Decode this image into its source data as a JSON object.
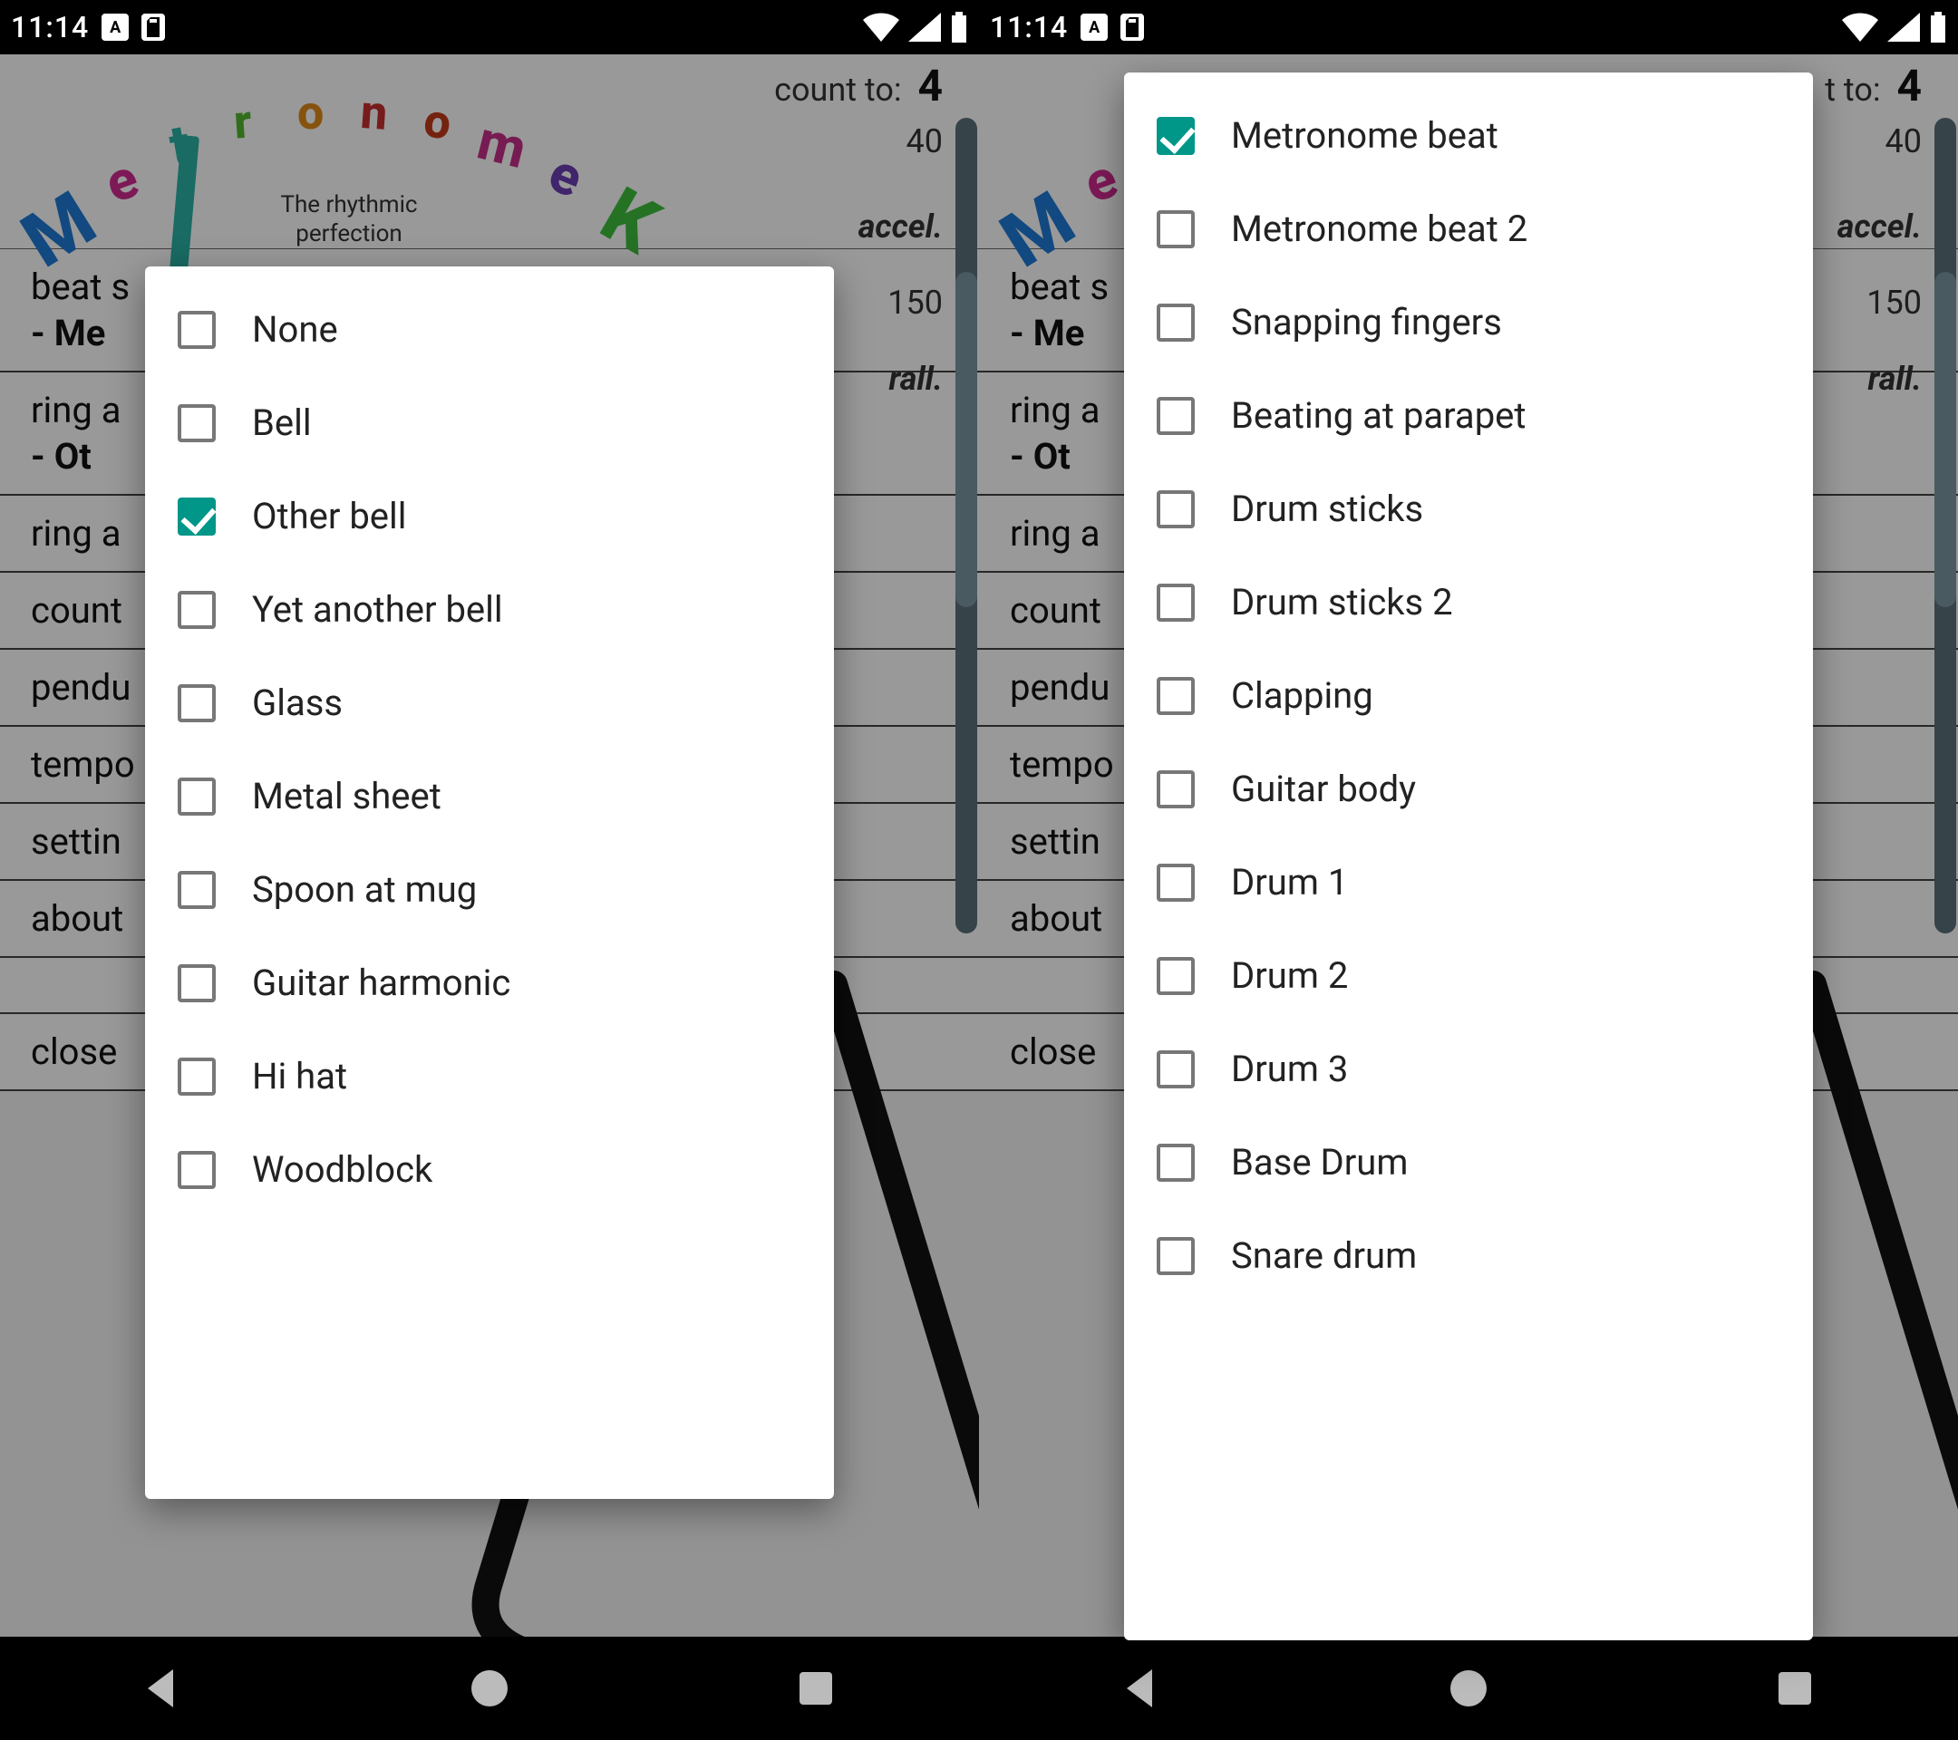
{
  "status": {
    "time": "11:14"
  },
  "app": {
    "tagline_l1": "The rhythmic",
    "tagline_l2": "perfection",
    "logo_letters": [
      {
        "ch": "M",
        "color": "#1e7ad6"
      },
      {
        "ch": "e",
        "color": "#d12b8f"
      },
      {
        "ch": "t",
        "color": "#2ab3a6"
      },
      {
        "ch": "r",
        "color": "#53b82e"
      },
      {
        "ch": "o",
        "color": "#e08b1a"
      },
      {
        "ch": "n",
        "color": "#c72f2f"
      },
      {
        "ch": "o",
        "color": "#c23b1a"
      },
      {
        "ch": "m",
        "color": "#c72f8a"
      },
      {
        "ch": "e",
        "color": "#6b3db5"
      },
      {
        "ch": "K",
        "color": "#3fbf3f"
      }
    ]
  },
  "menu": {
    "beat_line1": "beat s",
    "beat_line2": "- Me",
    "ring_line1": "ring a",
    "ring_line2": "- Ot",
    "ring2": "ring a",
    "count": "count",
    "pendu": "pendu",
    "tempo": "tempo",
    "settin": "settin",
    "about": "about",
    "close": "close"
  },
  "right": {
    "count_label": "count to:",
    "count_val": "4",
    "num1": "40",
    "accel": "accel.",
    "num2": "150",
    "rall": "rall.",
    "right_cut": "t to:"
  },
  "popup_left": {
    "options": [
      {
        "label": "None",
        "checked": false
      },
      {
        "label": "Bell",
        "checked": false
      },
      {
        "label": "Other bell",
        "checked": true
      },
      {
        "label": "Yet another bell",
        "checked": false
      },
      {
        "label": "Glass",
        "checked": false
      },
      {
        "label": "Metal sheet",
        "checked": false
      },
      {
        "label": "Spoon at mug",
        "checked": false
      },
      {
        "label": "Guitar harmonic",
        "checked": false
      },
      {
        "label": "Hi hat",
        "checked": false
      },
      {
        "label": "Woodblock",
        "checked": false
      }
    ]
  },
  "popup_right": {
    "options": [
      {
        "label": "Metronome beat",
        "checked": true
      },
      {
        "label": "Metronome beat 2",
        "checked": false
      },
      {
        "label": "Snapping fingers",
        "checked": false
      },
      {
        "label": "Beating at parapet",
        "checked": false
      },
      {
        "label": "Drum sticks",
        "checked": false
      },
      {
        "label": "Drum sticks 2",
        "checked": false
      },
      {
        "label": "Clapping",
        "checked": false
      },
      {
        "label": "Guitar body",
        "checked": false
      },
      {
        "label": "Drum 1",
        "checked": false
      },
      {
        "label": "Drum 2",
        "checked": false
      },
      {
        "label": "Drum 3",
        "checked": false
      },
      {
        "label": "Base Drum",
        "checked": false
      },
      {
        "label": "Snare drum",
        "checked": false
      }
    ]
  }
}
